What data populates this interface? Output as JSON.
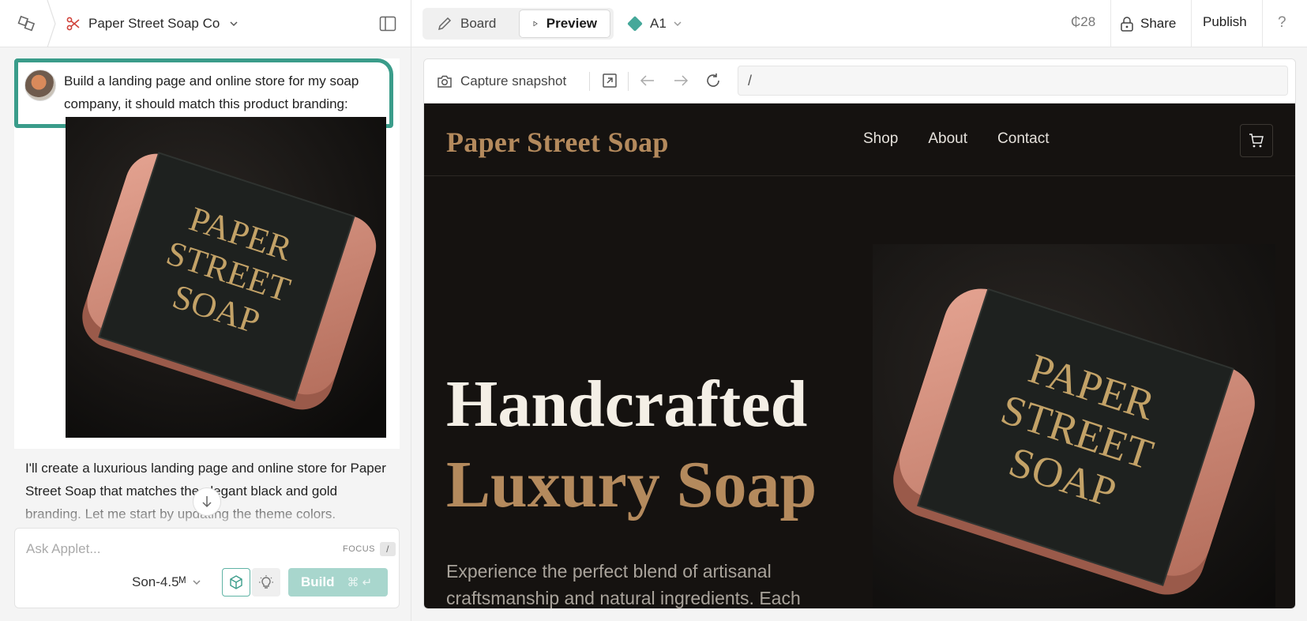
{
  "topbar": {
    "project_name": "Paper Street Soap Co",
    "view_tabs": [
      {
        "label": "Board",
        "active": false
      },
      {
        "label": "Preview",
        "active": true
      }
    ],
    "variant": "A1",
    "credits": "₵28",
    "share_label": "Share",
    "publish_label": "Publish",
    "help_label": "?"
  },
  "chat": {
    "prompt": "Build a landing page and online store for my soap company, it should match this product branding:",
    "attachment_label_lines": [
      "PAPER",
      "STREET",
      "SOAP"
    ],
    "reply": "I'll create a luxurious landing page and online store for Paper Street Soap that matches the elegant black and gold branding. Let me start by updating the theme colors."
  },
  "composer": {
    "placeholder": "Ask Applet...",
    "focus_hint": "FOCUS",
    "focus_key": "/",
    "model": "Son-4.5ᴹ",
    "build_label": "Build",
    "build_shortcut": "⌘ ↵"
  },
  "browser": {
    "capture_label": "Capture snapshot",
    "url": "/"
  },
  "site": {
    "logo": "Paper Street Soap",
    "nav": [
      "Shop",
      "About",
      "Contact"
    ],
    "hero_line1": "Handcrafted",
    "hero_line2": "Luxury Soap",
    "hero_text": "Experience the perfect blend of artisanal craftsmanship and natural ingredients. Each",
    "product_label_lines": [
      "PAPER",
      "STREET",
      "SOAP"
    ]
  },
  "colors": {
    "accent_teal": "#3a9c8a",
    "gold": "#b48a5d",
    "site_bg": "#151210",
    "soap_pink": "#d58c7a"
  }
}
